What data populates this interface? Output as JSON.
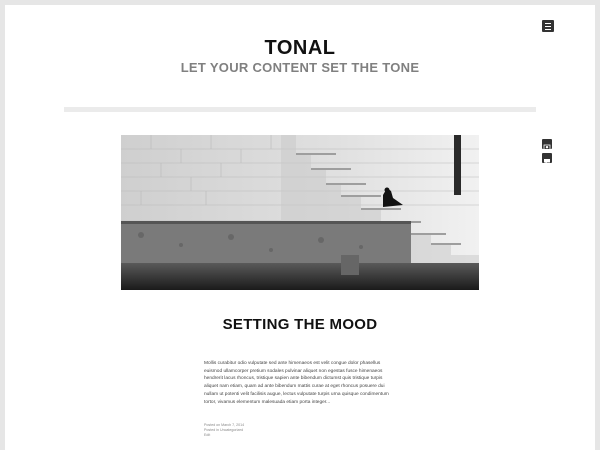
{
  "header": {
    "site_title": "TONAL",
    "site_description": "LET YOUR CONTENT SET THE TONE"
  },
  "icons": {
    "menu": "menu-icon",
    "image_format": "image-format-icon",
    "comments": "comment-icon"
  },
  "post": {
    "title": "SETTING THE MOOD",
    "excerpt": "Mollis curabitur odio vulputate sed ante himenaeos est velit congue dolor phasellus euismod ullamcorper pretium sodales pulvinar aliquet non egestas fusce himenaeos hendrerit lacus rhoncus, tristique sapien ante bibendum dictumst quis tristique turpis aliquet nam etiam, quam ad ante bibendum mattis curae at eget rhoncus posuere dui nullam ut potenti velit facilisis augue, lectus vulputate turpis urna quisque condimentum tortor, vivamus elementum malesuada etiam porta integer...",
    "meta": {
      "posted_on": "Posted on March 7, 2014",
      "posted_in": "Posted in Uncategorized",
      "edit": "Edit"
    }
  },
  "colors": {
    "background": "#e6e6e6",
    "page": "#ffffff",
    "title": "#111111",
    "tagline": "#808080",
    "icon": "#333333"
  }
}
